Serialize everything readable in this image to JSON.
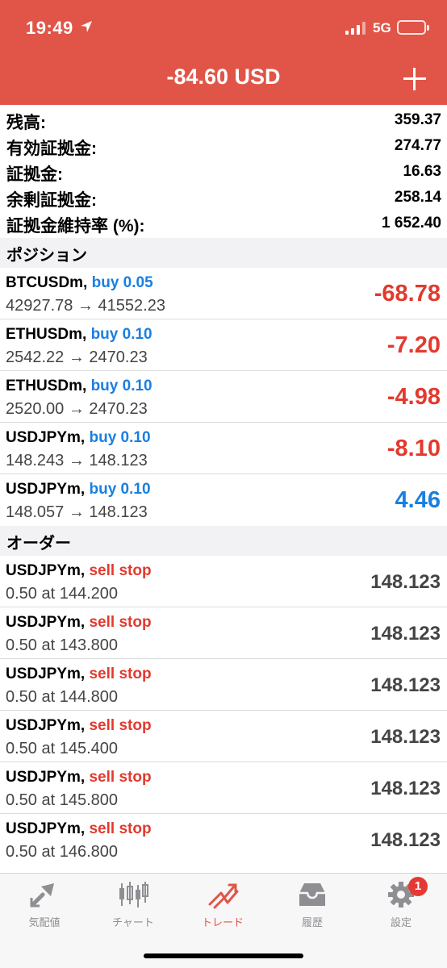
{
  "status_bar": {
    "time": "19:49",
    "network": "5G"
  },
  "header": {
    "title": "-84.60 USD"
  },
  "summary": [
    {
      "label": "残高:",
      "value": "359.37"
    },
    {
      "label": "有効証拠金:",
      "value": "274.77"
    },
    {
      "label": "証拠金:",
      "value": "16.63"
    },
    {
      "label": "余剰証拠金:",
      "value": "258.14"
    },
    {
      "label": "証拠金維持率 (%):",
      "value": "1 652.40"
    }
  ],
  "positions_header": "ポジション",
  "positions": [
    {
      "symbol": "BTCUSDm,",
      "side": "buy 0.05",
      "prices": "42927.78 → 41552.23",
      "profit": "-68.78"
    },
    {
      "symbol": "ETHUSDm,",
      "side": "buy 0.10",
      "prices": "2542.22 → 2470.23",
      "profit": "-7.20"
    },
    {
      "symbol": "ETHUSDm,",
      "side": "buy 0.10",
      "prices": "2520.00 → 2470.23",
      "profit": "-4.98"
    },
    {
      "symbol": "USDJPYm,",
      "side": "buy 0.10",
      "prices": "148.243 → 148.123",
      "profit": "-8.10"
    },
    {
      "symbol": "USDJPYm,",
      "side": "buy 0.10",
      "prices": "148.057 → 148.123",
      "profit": "4.46"
    }
  ],
  "orders_header": "オーダー",
  "orders": [
    {
      "symbol": "USDJPYm,",
      "type": "sell stop",
      "detail": "0.50 at 144.200",
      "price": "148.123"
    },
    {
      "symbol": "USDJPYm,",
      "type": "sell stop",
      "detail": "0.50 at 143.800",
      "price": "148.123"
    },
    {
      "symbol": "USDJPYm,",
      "type": "sell stop",
      "detail": "0.50 at 144.800",
      "price": "148.123"
    },
    {
      "symbol": "USDJPYm,",
      "type": "sell stop",
      "detail": "0.50 at 145.400",
      "price": "148.123"
    },
    {
      "symbol": "USDJPYm,",
      "type": "sell stop",
      "detail": "0.50 at 145.800",
      "price": "148.123"
    },
    {
      "symbol": "USDJPYm,",
      "type": "sell stop",
      "detail": "0.50 at 146.800",
      "price": "148.123"
    }
  ],
  "tabbar": {
    "tabs": [
      {
        "label": "気配値",
        "icon": "quotes-icon"
      },
      {
        "label": "チャート",
        "icon": "candlestick-chart-icon"
      },
      {
        "label": "トレード",
        "icon": "trade-icon"
      },
      {
        "label": "履歴",
        "icon": "inbox-tray-icon"
      },
      {
        "label": "設定",
        "icon": "gear-icon"
      }
    ],
    "active_tab": "トレード",
    "settings_badge": "1"
  },
  "colors": {
    "header_red": "#e05547",
    "buy_blue": "#1a7fe0",
    "sell_red": "#e23a2e",
    "loss_red": "#e23a2e",
    "profit_blue": "#1a7fe0"
  }
}
